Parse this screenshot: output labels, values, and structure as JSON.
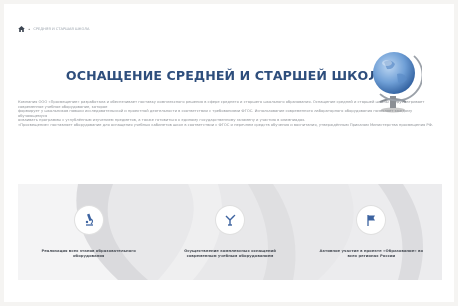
{
  "breadcrumb": {
    "current": "СРЕДНЯЯ И СТАРШАЯ ШКОЛА"
  },
  "page_title": "ОСНАЩЕНИЕ СРЕДНЕЙ И СТАРШЕЙ ШКОЛЫ",
  "intro_paragraphs": [
    "Компания ООО «Просвещение» разработала и обеспечивает поставку комплексного решения в сфере среднего и старшего школьного образования. Оснащение средней и старшей школы предусматривает современное учебное оборудование, которое",
    "формирует у школьников навыки исследовательской и проектной деятельности в соответствии с требованиями ФГОС. Использование современного лабораторного оборудования позволяет каждому обучающемуся",
    "осваивать программы с углублённым изучением предметов, а также готовиться к единому государственному экзамену и участию в олимпиадах.",
    "«Просвещение» поставляет оборудование для оснащения учебных кабинетов школ в соответствии с ФГОС и перечнем средств обучения и воспитания, утверждённым Приказом Министерства просвещения РФ."
  ],
  "features": [
    {
      "label": "Реализация всех этапов образовательного оборудования",
      "icon": "microscope-icon"
    },
    {
      "label": "Осуществление комплексных оснащений современным учебным оборудованием",
      "icon": "stamp-icon"
    },
    {
      "label": "Активное участие в проекте «Образование» во всех регионах России",
      "icon": "flag-icon"
    }
  ],
  "colors": {
    "title": "#2e4e7c",
    "icon_blue": "#3d63a0",
    "band": "#e8e8ea",
    "text_muted": "#8b8f94"
  }
}
